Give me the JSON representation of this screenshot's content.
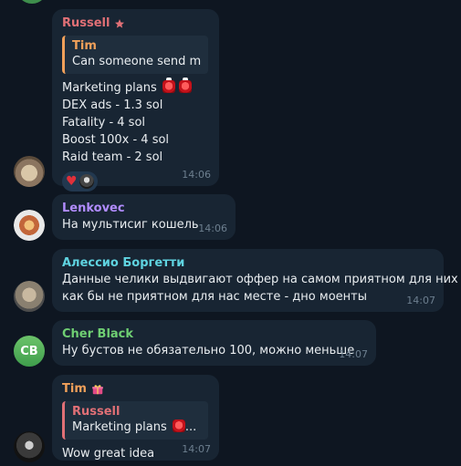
{
  "colors": {
    "background": "#0e1621",
    "bubble": "#182533",
    "russell_name": "#e17076",
    "tim_name": "#f0a05a",
    "lenkovec_name": "#b18cff",
    "alessio_name": "#5fd3e0",
    "cher_name": "#6fcf73",
    "time": "#6d7f8f"
  },
  "messages": [
    {
      "sender": "Russell",
      "badge_icon": "star-icon",
      "reply": {
        "name": "Tim",
        "text": "Can someone send m..."
      },
      "lines": [
        "Marketing plans",
        "DEX ads - 1.3 sol",
        "Fatality - 4 sol",
        "Boost 100x - 4 sol",
        "Raid team - 2 sol"
      ],
      "reactions": [
        "heart-icon",
        "reactor-avatar"
      ],
      "time": "14:06"
    },
    {
      "sender": "Lenkovec",
      "text": "На мультисиг кошель",
      "time": "14:06"
    },
    {
      "sender": "Алессио Боргетти",
      "lines": [
        "Данные челики выдвигают оффер на самом приятном для них и",
        "как бы не приятном для нас месте - дно моенты"
      ],
      "time": "14:07"
    },
    {
      "sender": "Cher Black",
      "avatar_initials": "CB",
      "text": "Ну бустов не обязательно 100, можно меньше",
      "time": "14:07"
    },
    {
      "sender": "Tim",
      "badge_icon": "gift-icon",
      "reply": {
        "name": "Russell",
        "text": "Marketing plans"
      },
      "text": "Wow great idea",
      "time": "14:07"
    }
  ]
}
